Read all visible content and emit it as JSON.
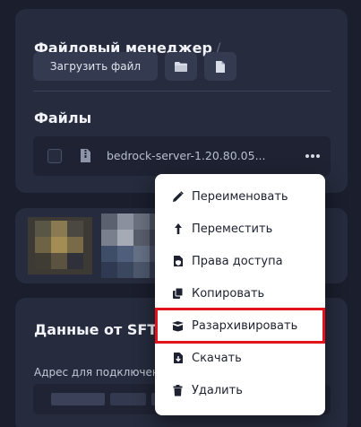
{
  "file_manager": {
    "title": "Файловый менеджер",
    "separator": "/",
    "upload_label": "Загрузить файл",
    "new_folder_icon": "folder-icon",
    "new_file_icon": "file-icon"
  },
  "files": {
    "title": "Файлы",
    "rows": [
      {
        "name": "bedrock-server-1.20.80.05...",
        "icon": "archive-file-icon"
      }
    ]
  },
  "context_menu": {
    "items": [
      {
        "label": "Переименовать",
        "icon": "pencil-icon"
      },
      {
        "label": "Переместить",
        "icon": "arrow-up-icon"
      },
      {
        "label": "Права доступа",
        "icon": "file-shield-icon"
      },
      {
        "label": "Копировать",
        "icon": "copy-icon"
      },
      {
        "label": "Разархивировать",
        "icon": "box-open-icon",
        "highlighted": true
      },
      {
        "label": "Скачать",
        "icon": "download-icon"
      },
      {
        "label": "Удалить",
        "icon": "trash-icon"
      }
    ]
  },
  "sftp": {
    "title": "Данные от SFTP",
    "address_label": "Адрес для подключения"
  },
  "colors": {
    "background": "#1a1e2d",
    "card": "#262b3d",
    "highlight_outline": "#e0121b"
  }
}
